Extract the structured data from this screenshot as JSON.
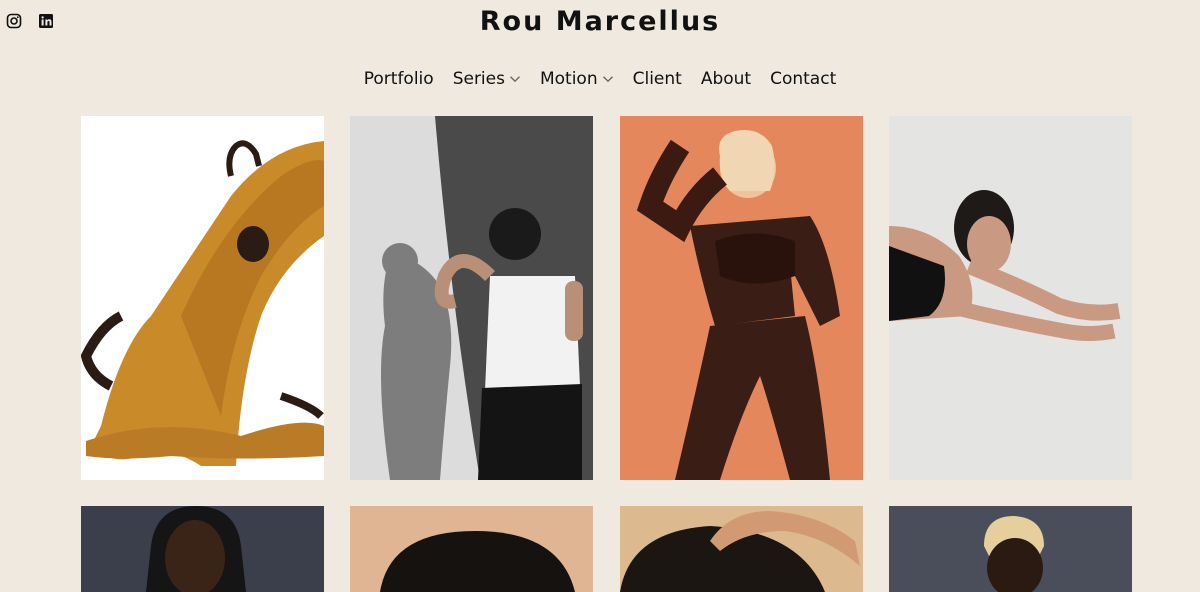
{
  "site": {
    "title": "Rou Marcellus"
  },
  "social": [
    {
      "icon": "instagram-icon"
    },
    {
      "icon": "linkedin-icon"
    }
  ],
  "nav": {
    "items": [
      {
        "label": "Portfolio",
        "has_dropdown": false
      },
      {
        "label": "Series",
        "has_dropdown": true
      },
      {
        "label": "Motion",
        "has_dropdown": true
      },
      {
        "label": "Client",
        "has_dropdown": false
      },
      {
        "label": "About",
        "has_dropdown": false
      },
      {
        "label": "Contact",
        "has_dropdown": false
      }
    ]
  },
  "colors": {
    "background": "#efe9df",
    "text": "#111111",
    "chevron": "#666666"
  },
  "gallery": {
    "tiles": [
      {
        "name": "dancer-in-gold-silk"
      },
      {
        "name": "model-shadow-on-wall"
      },
      {
        "name": "model-on-orange"
      },
      {
        "name": "model-reclining-grey"
      },
      {
        "name": "portrait-braids-dark"
      },
      {
        "name": "hair-on-beige"
      },
      {
        "name": "hand-on-curly-hair"
      },
      {
        "name": "portrait-bleached-hair"
      }
    ]
  }
}
